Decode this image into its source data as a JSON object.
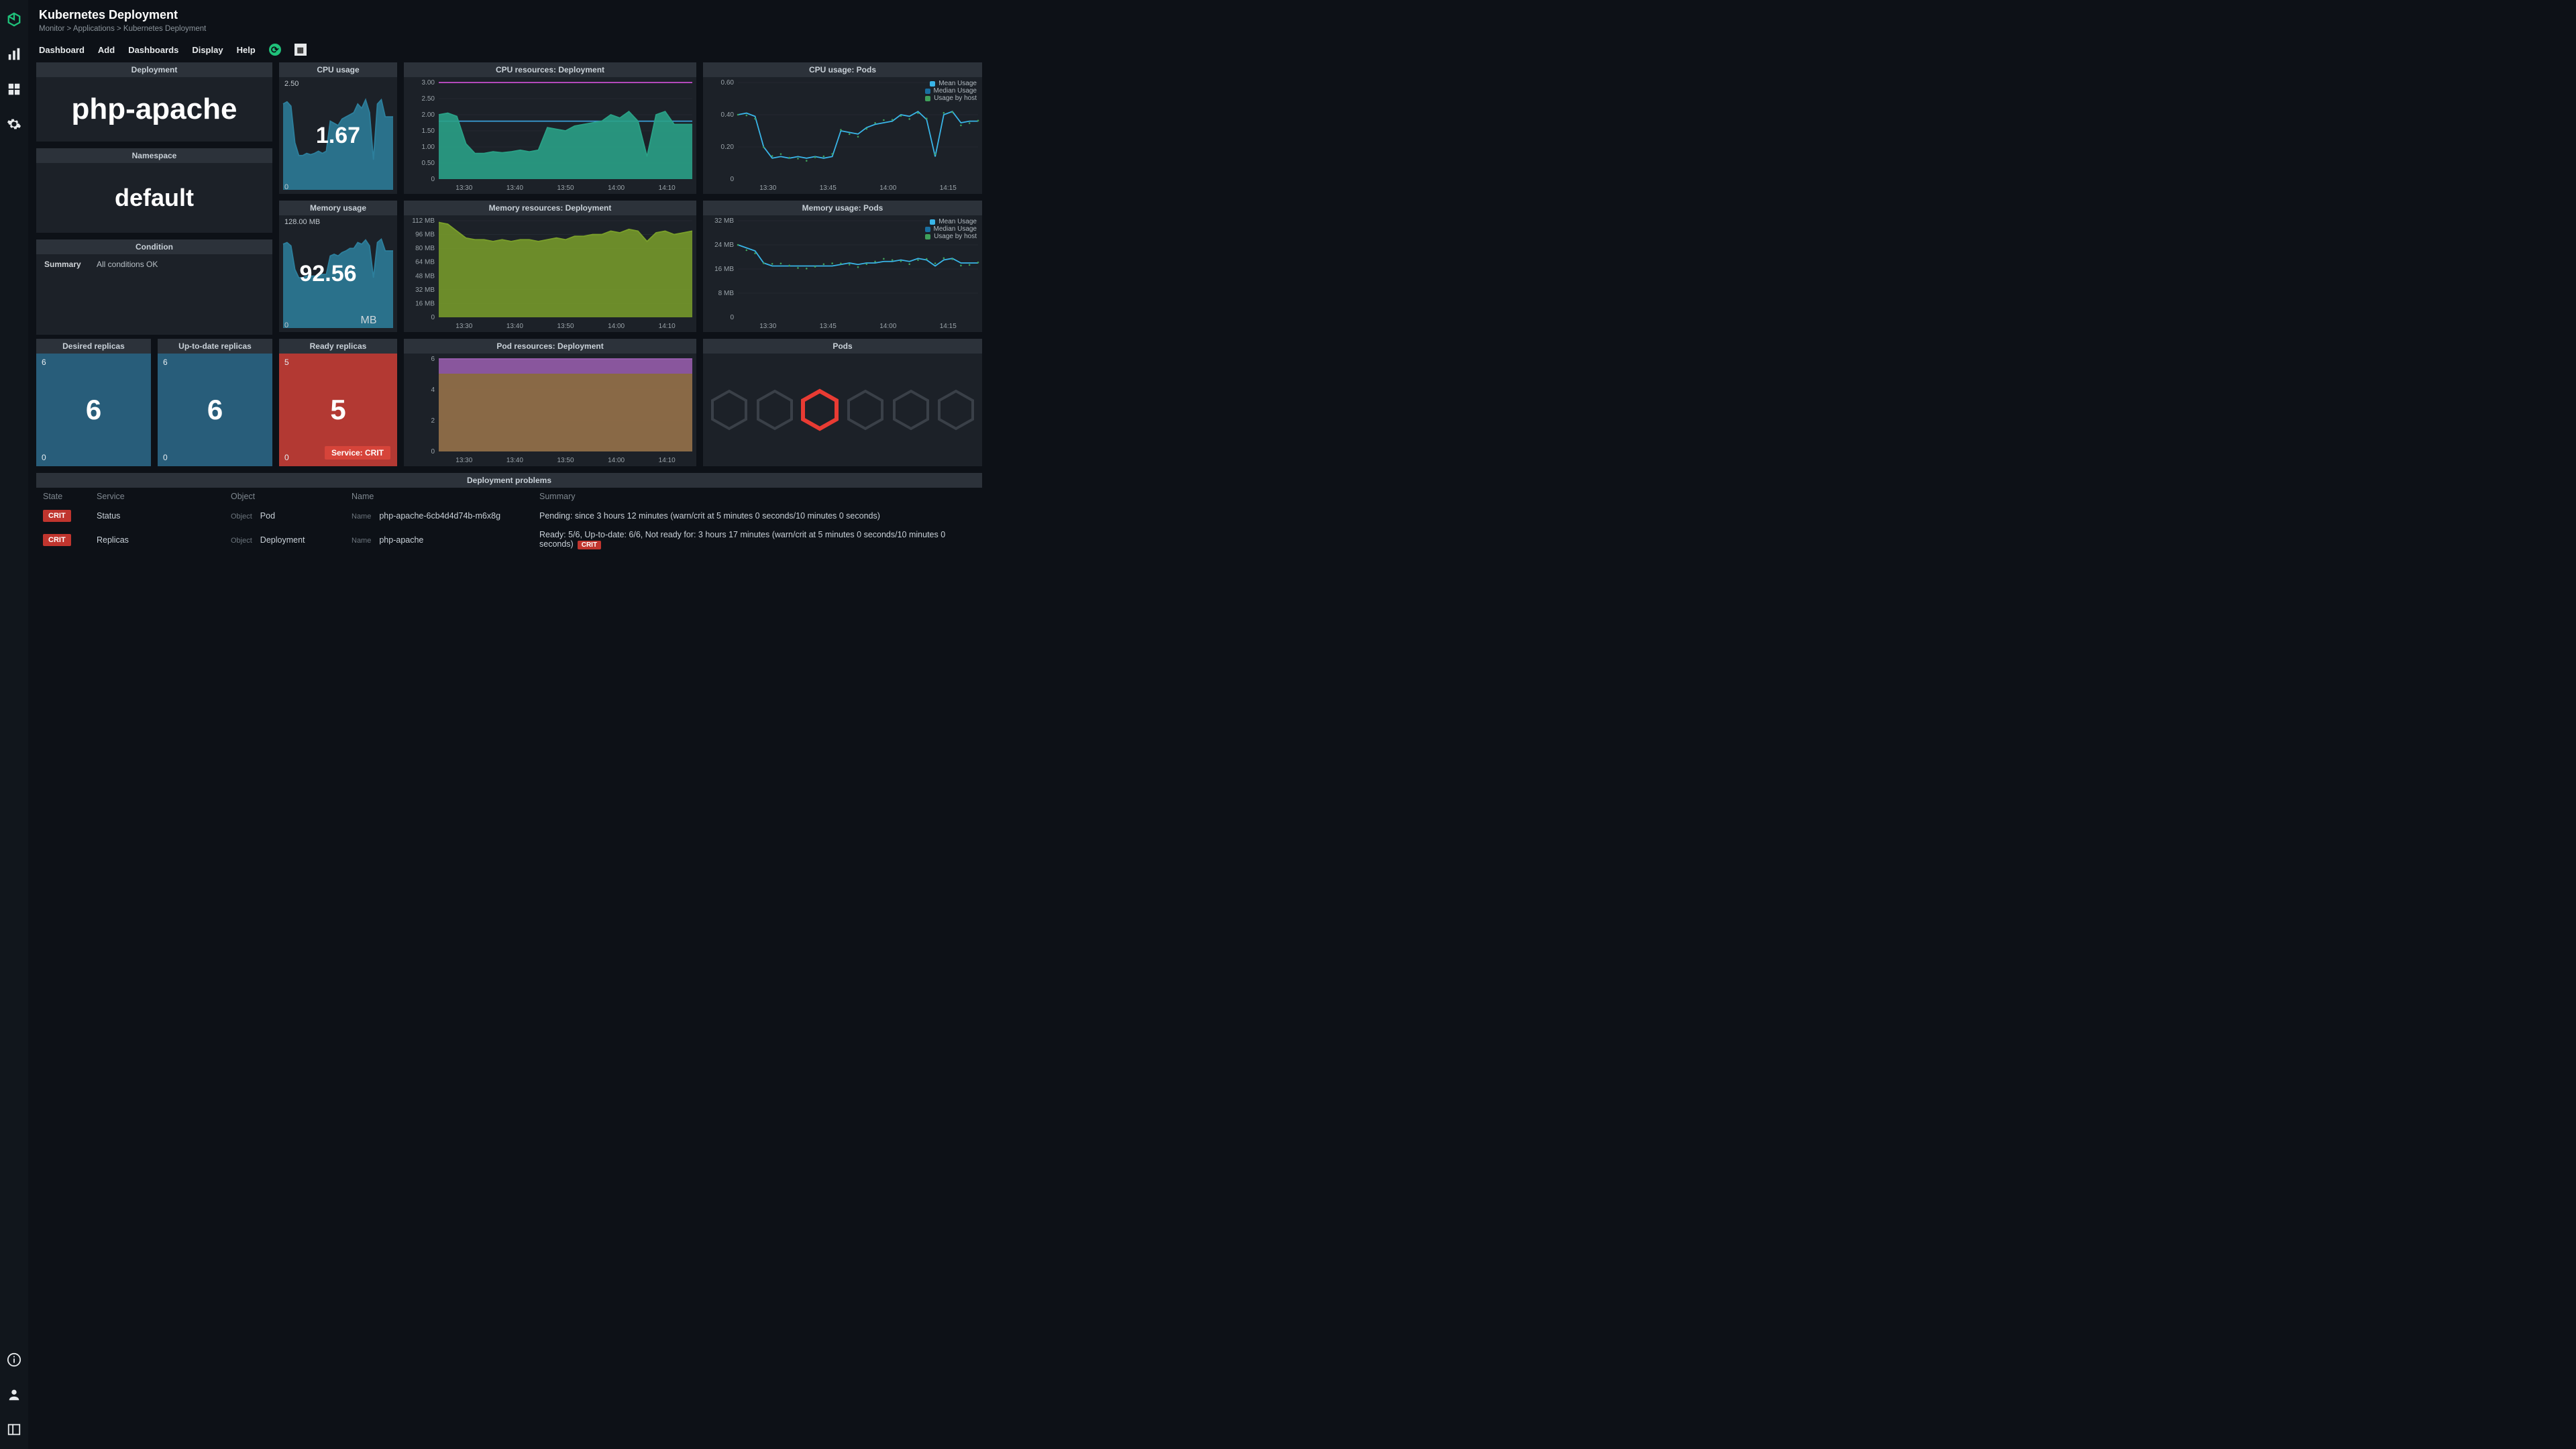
{
  "header": {
    "title": "Kubernetes Deployment",
    "breadcrumbs": "Monitor > Applications > Kubernetes Deployment"
  },
  "menubar": [
    "Dashboard",
    "Add",
    "Dashboards",
    "Display",
    "Help"
  ],
  "deployment": {
    "title": "Deployment",
    "value": "php-apache"
  },
  "namespace": {
    "title": "Namespace",
    "value": "default"
  },
  "condition": {
    "title": "Condition",
    "key": "Summary",
    "value": "All conditions OK"
  },
  "cpu_usage": {
    "title": "CPU usage",
    "top": "2.50",
    "value": "1.67",
    "bottom": "0"
  },
  "mem_usage": {
    "title": "Memory usage",
    "top": "128.00 MB",
    "value": "92.56",
    "unit": "MB",
    "bottom": "0"
  },
  "cpu_res": {
    "title": "CPU resources: Deployment"
  },
  "mem_res": {
    "title": "Memory resources: Deployment"
  },
  "cpu_pods": {
    "title": "CPU usage: Pods"
  },
  "mem_pods": {
    "title": "Memory usage: Pods"
  },
  "pod_res": {
    "title": "Pod resources: Deployment"
  },
  "pods_title": "Pods",
  "desired": {
    "title": "Desired replicas",
    "max": "6",
    "min": "0",
    "value": "6"
  },
  "uptodate": {
    "title": "Up-to-date replicas",
    "max": "6",
    "min": "0",
    "value": "6"
  },
  "ready": {
    "title": "Ready replicas",
    "max": "5",
    "min": "0",
    "value": "5",
    "badge": "Service: CRIT"
  },
  "legend": {
    "mean": "Mean Usage",
    "median": "Median Usage",
    "host": "Usage by host"
  },
  "problems": {
    "title": "Deployment problems",
    "headers": {
      "state": "State",
      "service": "Service",
      "object": "Object",
      "name": "Name",
      "summary": "Summary"
    },
    "labels": {
      "object": "Object",
      "name": "Name"
    },
    "rows": [
      {
        "state": "CRIT",
        "service": "Status",
        "obj": "Pod",
        "name": "php-apache-6cb4d4d74b-m6x8g",
        "summary": "Pending: since 3 hours 12 minutes (warn/crit at 5 minutes 0 seconds/10 minutes 0 seconds)",
        "crit": false
      },
      {
        "state": "CRIT",
        "service": "Replicas",
        "obj": "Deployment",
        "name": "php-apache",
        "summary": "Ready: 5/6, Up-to-date: 6/6, Not ready for: 3 hours 17 minutes (warn/crit at 5 minutes 0 seconds/10 minutes 0 seconds)",
        "crit": true
      }
    ]
  },
  "chart_data": [
    {
      "type": "area",
      "title": "CPU usage",
      "ylim": [
        0,
        2.5
      ],
      "series": [
        {
          "name": "cpu",
          "values": [
            2.0,
            2.05,
            1.95,
            1.1,
            0.8,
            0.8,
            0.85,
            0.82,
            0.85,
            0.9,
            0.85,
            0.9,
            1.6,
            1.55,
            1.5,
            1.65,
            1.7,
            1.75,
            1.8,
            2.0,
            1.9,
            2.1,
            1.8,
            0.7,
            2.0,
            2.1,
            1.7,
            1.7,
            1.7
          ]
        }
      ]
    },
    {
      "type": "area",
      "title": "Memory usage",
      "ylim": [
        0,
        128
      ],
      "series": [
        {
          "name": "mem",
          "values": [
            100,
            102,
            98,
            70,
            60,
            60,
            62,
            62,
            62,
            62,
            64,
            64,
            86,
            88,
            86,
            90,
            92,
            95,
            95,
            102,
            100,
            105,
            98,
            60,
            102,
            106,
            92,
            92,
            92
          ]
        }
      ]
    },
    {
      "type": "area",
      "title": "CPU resources: Deployment",
      "ylim": [
        0,
        3
      ],
      "xticks": [
        "13:30",
        "13:40",
        "13:50",
        "14:00",
        "14:10"
      ],
      "yticks": [
        "0.50",
        "1.00",
        "1.50",
        "2.00",
        "2.50",
        "3.00"
      ],
      "series": [
        {
          "name": "limit",
          "color": "#c84fcf",
          "values": [
            3,
            3,
            3,
            3,
            3,
            3,
            3,
            3,
            3,
            3,
            3,
            3,
            3,
            3,
            3,
            3,
            3,
            3,
            3,
            3,
            3,
            3,
            3,
            3,
            3,
            3,
            3,
            3,
            3
          ]
        },
        {
          "name": "request",
          "color": "#3aa0d9",
          "values": [
            1.8,
            1.8,
            1.8,
            1.8,
            1.8,
            1.8,
            1.8,
            1.8,
            1.8,
            1.8,
            1.8,
            1.8,
            1.8,
            1.8,
            1.8,
            1.8,
            1.8,
            1.8,
            1.8,
            1.8,
            1.8,
            1.8,
            1.8,
            1.8,
            1.8,
            1.8,
            1.8,
            1.8,
            1.8
          ]
        },
        {
          "name": "usage",
          "color": "#2aa086",
          "values": [
            2.0,
            2.05,
            1.95,
            1.1,
            0.8,
            0.8,
            0.85,
            0.82,
            0.85,
            0.9,
            0.85,
            0.9,
            1.6,
            1.55,
            1.5,
            1.65,
            1.7,
            1.75,
            1.8,
            2.0,
            1.9,
            2.1,
            1.8,
            0.7,
            2.0,
            2.1,
            1.7,
            1.7,
            1.7
          ]
        }
      ]
    },
    {
      "type": "area",
      "title": "Memory resources: Deployment",
      "ylim": [
        0,
        112
      ],
      "xticks": [
        "13:30",
        "13:40",
        "13:50",
        "14:00",
        "14:10"
      ],
      "yticks": [
        "16 MB",
        "32 MB",
        "48 MB",
        "64 MB",
        "80 MB",
        "96 MB",
        "112 MB"
      ],
      "series": [
        {
          "name": "mem",
          "color": "#7a9f2a",
          "values": [
            110,
            108,
            100,
            92,
            90,
            90,
            88,
            90,
            88,
            90,
            90,
            88,
            90,
            92,
            90,
            94,
            94,
            96,
            96,
            100,
            98,
            102,
            100,
            88,
            98,
            100,
            96,
            98,
            100
          ]
        }
      ]
    },
    {
      "type": "area",
      "title": "Pod resources: Deployment",
      "ylim": [
        0,
        6
      ],
      "xticks": [
        "13:30",
        "13:40",
        "13:50",
        "14:00",
        "14:10"
      ],
      "yticks": [
        "2",
        "4",
        "6"
      ],
      "series": [
        {
          "name": "total",
          "color": "#9c5fb2",
          "values": [
            6,
            6,
            6,
            6,
            6,
            6,
            6,
            6,
            6,
            6,
            6,
            6,
            6,
            6,
            6,
            6,
            6,
            6,
            6,
            6,
            6,
            6,
            6,
            6,
            6,
            6,
            6,
            6,
            6
          ]
        },
        {
          "name": "ready",
          "color": "#8a6b3d",
          "values": [
            5,
            5,
            5,
            5,
            5,
            5,
            5,
            5,
            5,
            5,
            5,
            5,
            5,
            5,
            5,
            5,
            5,
            5,
            5,
            5,
            5,
            5,
            5,
            5,
            5,
            5,
            5,
            5,
            5
          ]
        }
      ]
    },
    {
      "type": "line",
      "title": "CPU usage: Pods",
      "ylim": [
        0,
        0.6
      ],
      "xticks": [
        "13:30",
        "13:45",
        "14:00",
        "14:15"
      ],
      "yticks": [
        "0.20",
        "0.40",
        "0.60"
      ],
      "series": [
        {
          "name": "Mean Usage",
          "color": "#39b5e8",
          "values": [
            0.4,
            0.41,
            0.39,
            0.2,
            0.13,
            0.14,
            0.13,
            0.14,
            0.13,
            0.14,
            0.13,
            0.14,
            0.3,
            0.29,
            0.28,
            0.32,
            0.34,
            0.35,
            0.36,
            0.4,
            0.39,
            0.42,
            0.37,
            0.14,
            0.4,
            0.42,
            0.35,
            0.36,
            0.36
          ]
        }
      ]
    },
    {
      "type": "line",
      "title": "Memory usage: Pods",
      "ylim": [
        0,
        32
      ],
      "xticks": [
        "13:30",
        "13:45",
        "14:00",
        "14:15"
      ],
      "yticks": [
        "8 MB",
        "16 MB",
        "24 MB",
        "32 MB"
      ],
      "series": [
        {
          "name": "Mean Usage",
          "color": "#39b5e8",
          "values": [
            24,
            23,
            22,
            18,
            17,
            17,
            17,
            17,
            17,
            17,
            17,
            17,
            17.5,
            18,
            17.5,
            18,
            18,
            18.5,
            18.5,
            19,
            18.5,
            19.5,
            19,
            17,
            19,
            19.5,
            18,
            18,
            18
          ]
        }
      ]
    }
  ]
}
